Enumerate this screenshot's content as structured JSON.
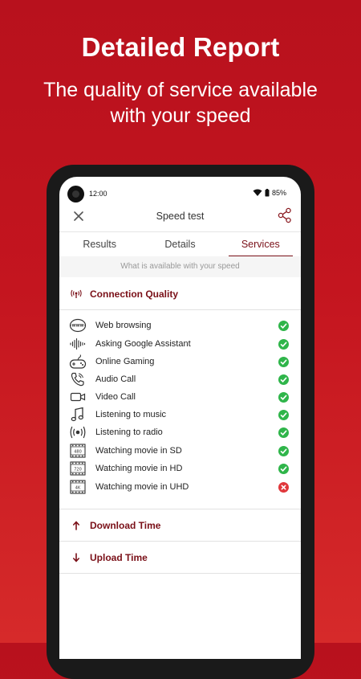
{
  "hero": {
    "title": "Detailed Report",
    "subtitle": "The quality of service available with your speed"
  },
  "status_bar": {
    "time": "12:00",
    "battery": "85%"
  },
  "app_bar": {
    "title": "Speed test"
  },
  "tabs": [
    {
      "label": "Results",
      "active": false
    },
    {
      "label": "Details",
      "active": false
    },
    {
      "label": "Services",
      "active": true
    }
  ],
  "subtitle": "What is available with your speed",
  "connection_quality": {
    "label": "Connection Quality",
    "items": [
      {
        "label": "Web browsing",
        "icon": "www-icon",
        "available": true
      },
      {
        "label": "Asking Google Assistant",
        "icon": "voice-waveform-icon",
        "available": true
      },
      {
        "label": "Online Gaming",
        "icon": "gamepad-icon",
        "available": true
      },
      {
        "label": "Audio Call",
        "icon": "phone-call-icon",
        "available": true
      },
      {
        "label": "Video Call",
        "icon": "video-camera-icon",
        "available": true
      },
      {
        "label": "Listening to music",
        "icon": "music-note-icon",
        "available": true
      },
      {
        "label": "Listening to radio",
        "icon": "radio-broadcast-icon",
        "available": true
      },
      {
        "label": "Watching movie in SD",
        "icon": "film-480-icon",
        "badge": "480",
        "available": true
      },
      {
        "label": "Watching movie in HD",
        "icon": "film-720-icon",
        "badge": "720",
        "available": true
      },
      {
        "label": "Watching movie in UHD",
        "icon": "film-4k-icon",
        "badge": "4K",
        "available": false
      }
    ]
  },
  "download_time": {
    "label": "Download Time"
  },
  "upload_time": {
    "label": "Upload Time"
  },
  "colors": {
    "brand": "#c4151f",
    "accent": "#7a1018",
    "ok": "#2fb54a",
    "bad": "#e0373b"
  }
}
